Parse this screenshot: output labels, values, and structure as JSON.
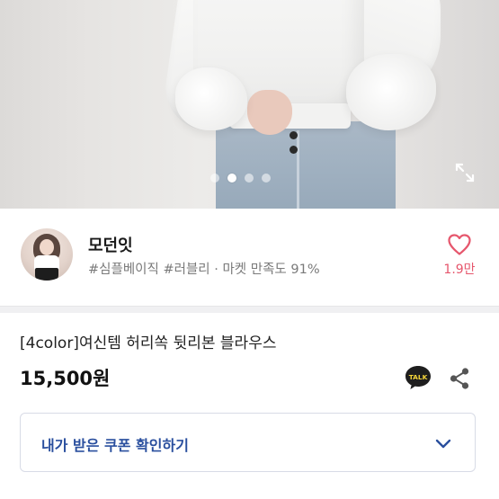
{
  "gallery": {
    "dot_count": 4,
    "active_dot_index": 1
  },
  "shop": {
    "name": "모던잇",
    "tags": "#심플베이직 #러블리 · 마켓 만족도 91%",
    "like_count": "1.9만"
  },
  "product": {
    "title": "[4color]여신템 허리쏙 뒷리본 블라우스",
    "price": "15,500원"
  },
  "actions": {
    "talk_label": "TALK"
  },
  "coupon": {
    "label": "내가 받은 쿠폰 확인하기"
  },
  "colors": {
    "like_accent": "#e6576d",
    "coupon_text": "#2a4f9e",
    "talk_bg": "#1e1e1e",
    "talk_text": "#f5d63a"
  },
  "icons": {
    "expand": "expand-icon",
    "heart": "heart-icon",
    "talk": "talk-icon",
    "share": "share-icon",
    "chevron": "chevron-down-icon"
  }
}
